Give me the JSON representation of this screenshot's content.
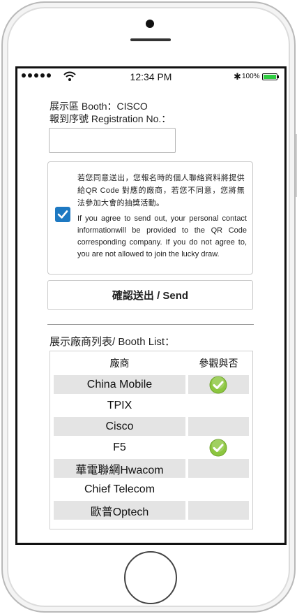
{
  "status_bar": {
    "time": "12:34 PM",
    "battery_percent": "100%",
    "signal_bars": 5
  },
  "form": {
    "booth_label": "展示區 Booth：CISCO",
    "registration_label": "報到序號 Registration No.：",
    "registration_value": ""
  },
  "consent": {
    "checked": true,
    "text_zh": "若您同意送出，您報名時的個人聯絡資料將提供給QR Code 對應的廠商，若您不同意，您將無法參加大會的抽獎活動。",
    "text_en": "If you agree to send out, your personal contact informationwill be provided to the QR Code corresponding company. If you do not agree to, you are not allowed to join the lucky draw."
  },
  "send_button_label": "確認送出 / Send",
  "booth_list": {
    "heading": "展示廠商列表/ Booth List：",
    "columns": [
      "廠商",
      "參觀與否"
    ],
    "rows": [
      {
        "name": "China Mobile",
        "visited": true
      },
      {
        "name": "TPIX",
        "visited": false
      },
      {
        "name": "Cisco",
        "visited": false
      },
      {
        "name": "F5",
        "visited": true
      },
      {
        "name": "華電聯網Hwacom",
        "visited": false
      },
      {
        "name": "Chief Telecom",
        "visited": false
      },
      {
        "name": "歐普Optech",
        "visited": false
      }
    ]
  },
  "colors": {
    "checkbox": "#1e79c2",
    "check_icon": "#8cc63f",
    "row_shade": "#e4e4e4",
    "battery": "#2ecc40"
  }
}
